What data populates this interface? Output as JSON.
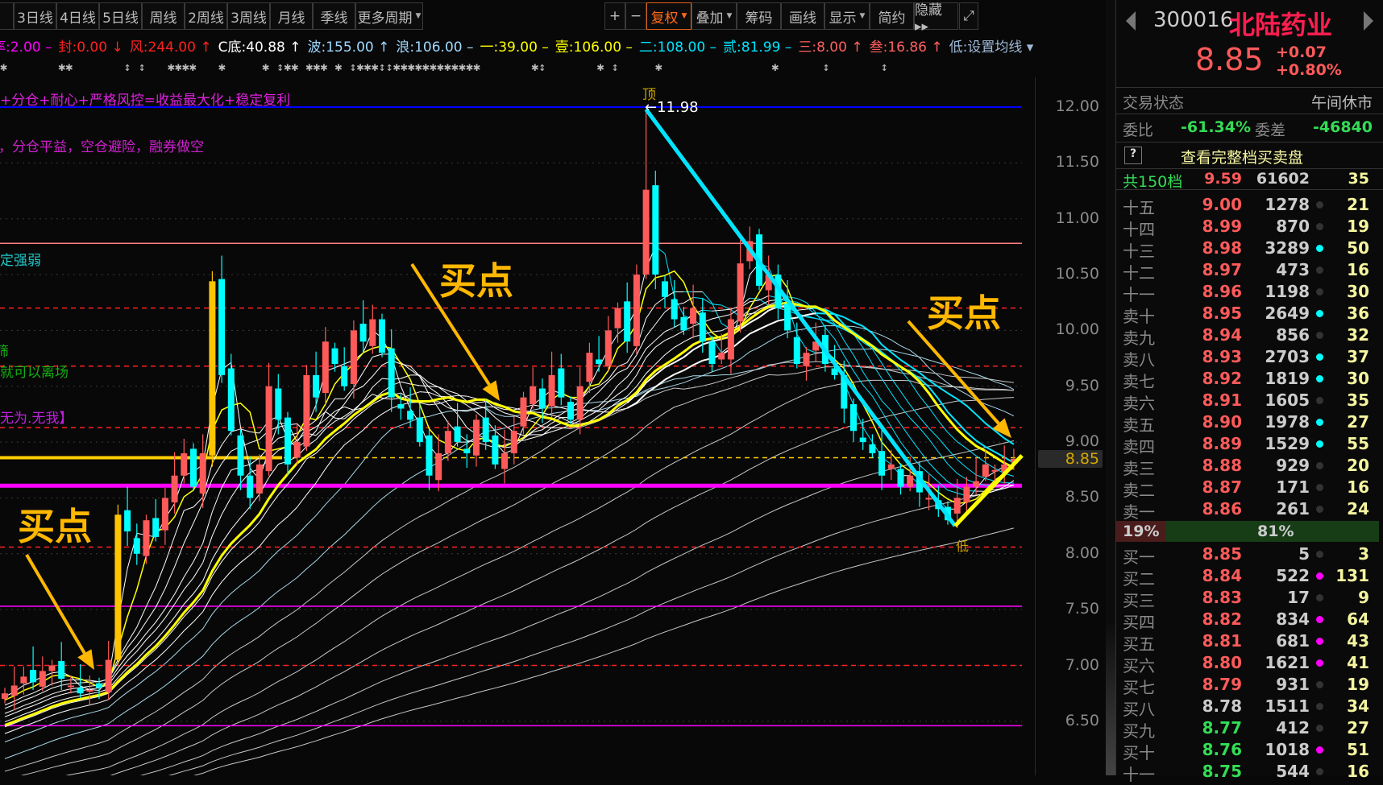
{
  "toolbar": {
    "periods": [
      "线",
      "3日线",
      "4日线",
      "5日线",
      "周线",
      "2周线",
      "3周线",
      "月线",
      "季线",
      "更多周期"
    ],
    "zoom_in": "+",
    "zoom_out": "−",
    "fuquan": "复权",
    "overlay": "叠加",
    "chips": "筹码",
    "draw": "画线",
    "display": "显示",
    "simple": "简约",
    "hide": "隐藏 ▸▸",
    "fullscreen": "⤢"
  },
  "indicators": [
    {
      "text": "率:2.00 –",
      "color": "#ff00ff"
    },
    {
      "text": "封:0.00 ↓",
      "color": "#ff2020"
    },
    {
      "text": "风:244.00 ↑",
      "color": "#ff2020"
    },
    {
      "text": "C底:40.88 ↑",
      "color": "#ffffff"
    },
    {
      "text": "波:155.00 ↑",
      "color": "#9fd8ff"
    },
    {
      "text": "浪:106.00 –",
      "color": "#9fd8ff"
    },
    {
      "text": "一:39.00 –",
      "color": "#ffff00"
    },
    {
      "text": "壹:106.00 –",
      "color": "#ffff00"
    },
    {
      "text": "二:108.00 –",
      "color": "#00e5ff"
    },
    {
      "text": "贰:81.99 –",
      "color": "#00e5ff"
    },
    {
      "text": "三:8.00 ↑",
      "color": "#ff6060"
    },
    {
      "text": "叁:16.86 ↑",
      "color": "#ff6060"
    },
    {
      "text": "低:设置均线 ▾",
      "color": "#9fb8d8"
    }
  ],
  "star_row": "✱       ✱✱       ↕ ↕   ✱✱✱✱   ✱     ✱ ↕✱✱ ✱✱✱ ✱ ↕✱✱✱↕↕✱✱✱✱✱✱✱✱✱✱✱✱       ✱↕       ✱ ↕     ✱               ✱      ↕       ↕",
  "notes": [
    {
      "text": "+分仓+耐心+严格风控=收益最大化+稳定复利",
      "color": "#e020e0"
    },
    {
      "text": "，分仓平益，空仓避险，融券做空",
      "color": "#d020d0"
    },
    {
      "text": "定强弱",
      "color": "#20c8c8"
    },
    {
      "text": "筛",
      "color": "#10b010"
    },
    {
      "text": "就可以离场",
      "color": "#10b010"
    },
    {
      "text": "无为.无我】",
      "color": "#c020e0"
    }
  ],
  "annotations": {
    "buy": "买点",
    "top": "顶",
    "top_value": "←11.98",
    "low": "低"
  },
  "axis": {
    "labels": [
      "12.00",
      "11.50",
      "11.00",
      "10.50",
      "10.00",
      "9.50",
      "9.00",
      "8.50",
      "8.00",
      "7.50",
      "7.00",
      "6.50"
    ],
    "current": "8.85"
  },
  "colors": {
    "up": "#ff5a5a",
    "down": "#00ffff",
    "accent": "#ffb800"
  },
  "kline": {
    "closes": [
      6.75,
      6.82,
      6.9,
      6.85,
      6.95,
      7.0,
      6.88,
      6.82,
      6.75,
      6.78,
      6.8,
      7.05,
      8.35,
      8.2,
      8.0,
      8.3,
      8.15,
      8.5,
      8.7,
      8.9,
      8.6,
      8.9,
      10.44,
      9.6,
      9.1,
      8.7,
      8.5,
      8.8,
      9.5,
      9.2,
      8.8,
      9.0,
      9.6,
      9.4,
      9.9,
      9.7,
      9.5,
      10.0,
      9.9,
      10.1,
      9.8,
      9.4,
      9.3,
      9.2,
      9.0,
      8.7,
      8.9,
      9.1,
      9.0,
      8.9,
      9.2,
      9.0,
      8.8,
      8.9,
      9.1,
      9.4,
      9.5,
      9.3,
      9.6,
      9.4,
      9.2,
      9.5,
      9.8,
      9.7,
      10.0,
      10.2,
      9.9,
      10.5,
      11.26,
      10.5,
      10.3,
      10.1,
      10.0,
      10.2,
      9.9,
      9.7,
      9.8,
      10.1,
      10.6,
      10.8,
      10.4,
      10.5,
      10.2,
      10.0,
      9.7,
      9.8,
      9.9,
      9.7,
      9.6,
      9.3,
      9.1,
      9.0,
      8.9,
      8.7,
      8.8,
      8.6,
      8.7,
      8.55,
      8.5,
      8.4,
      8.3,
      8.5,
      8.6,
      8.65,
      8.8,
      8.75,
      8.8,
      8.85
    ],
    "highlight_bars": [
      12,
      22
    ],
    "top_price": 11.98,
    "low_price": 8.25,
    "h_lines": [
      {
        "price": 12.0,
        "color": "#0000ff",
        "style": "solid"
      },
      {
        "price": 10.78,
        "color": "#ff8080",
        "style": "solid"
      },
      {
        "price": 10.2,
        "color": "#ff2020",
        "style": "dash"
      },
      {
        "price": 9.68,
        "color": "#ff2020",
        "style": "dash"
      },
      {
        "price": 9.13,
        "color": "#ff2020",
        "style": "dash"
      },
      {
        "price": 8.86,
        "color": "#ffd000",
        "style": "dash"
      },
      {
        "price": 8.61,
        "color": "#ff00ff",
        "style": "thick"
      },
      {
        "price": 8.06,
        "color": "#ff2020",
        "style": "dash"
      },
      {
        "price": 7.53,
        "color": "#ff00ff",
        "style": "solid"
      },
      {
        "price": 7.0,
        "color": "#ff2020",
        "style": "dash"
      },
      {
        "price": 6.46,
        "color": "#ff00ff",
        "style": "solid"
      }
    ]
  },
  "quote": {
    "code": "300016",
    "name": "北陆药业",
    "price": "8.85",
    "change": "+0.07",
    "change_pct": "+0.80%",
    "status_label": "交易状态",
    "status": "午间休市",
    "wb_label": "委比",
    "wb": "-61.34%",
    "wc_label": "委差",
    "wc": "-46840",
    "help": "?",
    "full_depth": "查看完整档买卖盘",
    "total_label": "共150档",
    "total_price": "9.59",
    "total_vol": "61602",
    "total_cnt": "35",
    "sell_pct": "19%",
    "buy_pct": "81%",
    "buy_ratio": 0.81
  },
  "sells": [
    {
      "l": "十五",
      "p": "9.00",
      "v": "1278",
      "d": "#333",
      "c": "21"
    },
    {
      "l": "十四",
      "p": "8.99",
      "v": "870",
      "d": "#333",
      "c": "19"
    },
    {
      "l": "十三",
      "p": "8.98",
      "v": "3289",
      "d": "#00ffff",
      "c": "50"
    },
    {
      "l": "十二",
      "p": "8.97",
      "v": "473",
      "d": "#333",
      "c": "16"
    },
    {
      "l": "十一",
      "p": "8.96",
      "v": "1198",
      "d": "#333",
      "c": "30"
    },
    {
      "l": "卖十",
      "p": "8.95",
      "v": "2649",
      "d": "#00ffff",
      "c": "36"
    },
    {
      "l": "卖九",
      "p": "8.94",
      "v": "856",
      "d": "#333",
      "c": "32"
    },
    {
      "l": "卖八",
      "p": "8.93",
      "v": "2703",
      "d": "#00ffff",
      "c": "37"
    },
    {
      "l": "卖七",
      "p": "8.92",
      "v": "1819",
      "d": "#00ffff",
      "c": "30"
    },
    {
      "l": "卖六",
      "p": "8.91",
      "v": "1605",
      "d": "#333",
      "c": "35"
    },
    {
      "l": "卖五",
      "p": "8.90",
      "v": "1978",
      "d": "#00ffff",
      "c": "27"
    },
    {
      "l": "卖四",
      "p": "8.89",
      "v": "1529",
      "d": "#00ffff",
      "c": "55"
    },
    {
      "l": "卖三",
      "p": "8.88",
      "v": "929",
      "d": "#333",
      "c": "20"
    },
    {
      "l": "卖二",
      "p": "8.87",
      "v": "171",
      "d": "#333",
      "c": "16"
    },
    {
      "l": "卖一",
      "p": "8.86",
      "v": "261",
      "d": "#333",
      "c": "24"
    }
  ],
  "buys": [
    {
      "l": "买一",
      "p": "8.85",
      "pc": "#ff5a5a",
      "v": "5",
      "d": "#333",
      "c": "3"
    },
    {
      "l": "买二",
      "p": "8.84",
      "pc": "#ff5a5a",
      "v": "522",
      "d": "#ff00ff",
      "c": "131"
    },
    {
      "l": "买三",
      "p": "8.83",
      "pc": "#ff5a5a",
      "v": "17",
      "d": "#333",
      "c": "9"
    },
    {
      "l": "买四",
      "p": "8.82",
      "pc": "#ff5a5a",
      "v": "834",
      "d": "#ff00ff",
      "c": "64"
    },
    {
      "l": "买五",
      "p": "8.81",
      "pc": "#ff5a5a",
      "v": "681",
      "d": "#ff00ff",
      "c": "43"
    },
    {
      "l": "买六",
      "p": "8.80",
      "pc": "#ff5a5a",
      "v": "1621",
      "d": "#ff00ff",
      "c": "41"
    },
    {
      "l": "买七",
      "p": "8.79",
      "pc": "#ff5a5a",
      "v": "931",
      "d": "#333",
      "c": "19"
    },
    {
      "l": "买八",
      "p": "8.78",
      "pc": "#cccccc",
      "v": "1511",
      "d": "#333",
      "c": "34"
    },
    {
      "l": "买九",
      "p": "8.77",
      "pc": "#33dd55",
      "v": "412",
      "d": "#333",
      "c": "27"
    },
    {
      "l": "买十",
      "p": "8.76",
      "pc": "#33dd55",
      "v": "1018",
      "d": "#ff00ff",
      "c": "51"
    },
    {
      "l": "十一",
      "p": "8.75",
      "pc": "#33dd55",
      "v": "544",
      "d": "#333",
      "c": "16"
    }
  ]
}
